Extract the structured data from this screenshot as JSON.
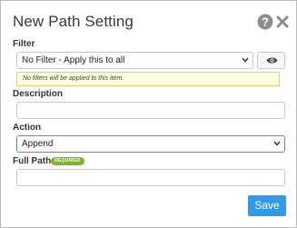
{
  "dialog": {
    "title": "New Path Setting",
    "icons": {
      "help": "question-circle-icon",
      "close": "close-icon",
      "eye": "eye-icon",
      "chevron": "chevron-down-icon"
    }
  },
  "filter": {
    "label": "Filter",
    "selected": "No Filter - Apply this to all",
    "note": "No filters will be applied to this item."
  },
  "description": {
    "label": "Description",
    "value": ""
  },
  "action": {
    "label": "Action",
    "selected": "Append"
  },
  "full_path": {
    "label": "Full Path",
    "badge": "REQUIRED",
    "value": ""
  },
  "buttons": {
    "save": "Save"
  },
  "colors": {
    "primary": "#2f9ae6",
    "required_badge": "#7fb42a",
    "action_select_border": "#4a90d9",
    "note_background": "#fdfde0"
  }
}
